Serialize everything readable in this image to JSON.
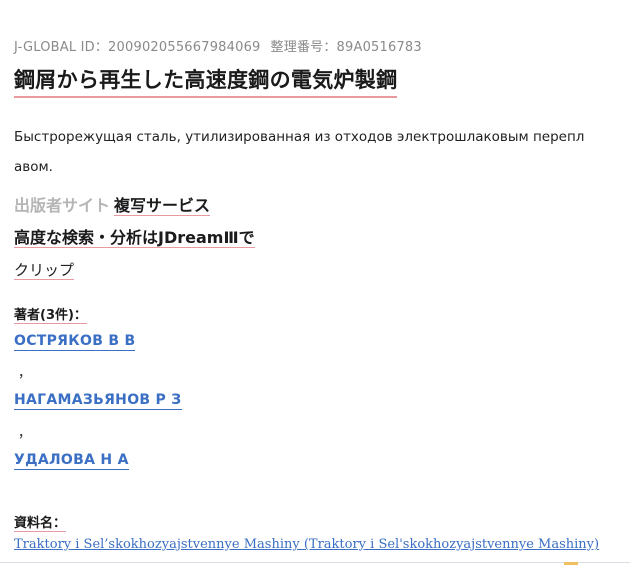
{
  "record": {
    "jglobal_id": "J-GLOBAL ID：200902055667984069",
    "reference_number": "整理番号：89A0516783"
  },
  "title": "鋼屑から再生した高速度鋼の電気炉製鋼",
  "alt_title": {
    "line1": "Быстрорежущая сталь, утилизированная  из отходов электрошлаковым перепл",
    "line2": "авом."
  },
  "links": {
    "publisher_site": "出版者サイト",
    "copy_service": "複写サービス",
    "jdream": "高度な検索・分析はJDreamⅢで",
    "clip": "クリップ"
  },
  "authors": {
    "label": "著者(3件)：",
    "items": [
      "ОСТРЯКОВ  В В",
      "НАГАМАЗЬЯНОВ  Р З",
      "УДАЛОВА  Н А"
    ],
    "separator": "，"
  },
  "source": {
    "label": "資料名：",
    "value": "Traktory i Sel’skokhozyajstvennye Mashiny  (Traktory i Sel'skokhozyajstvennye Mashiny)"
  }
}
